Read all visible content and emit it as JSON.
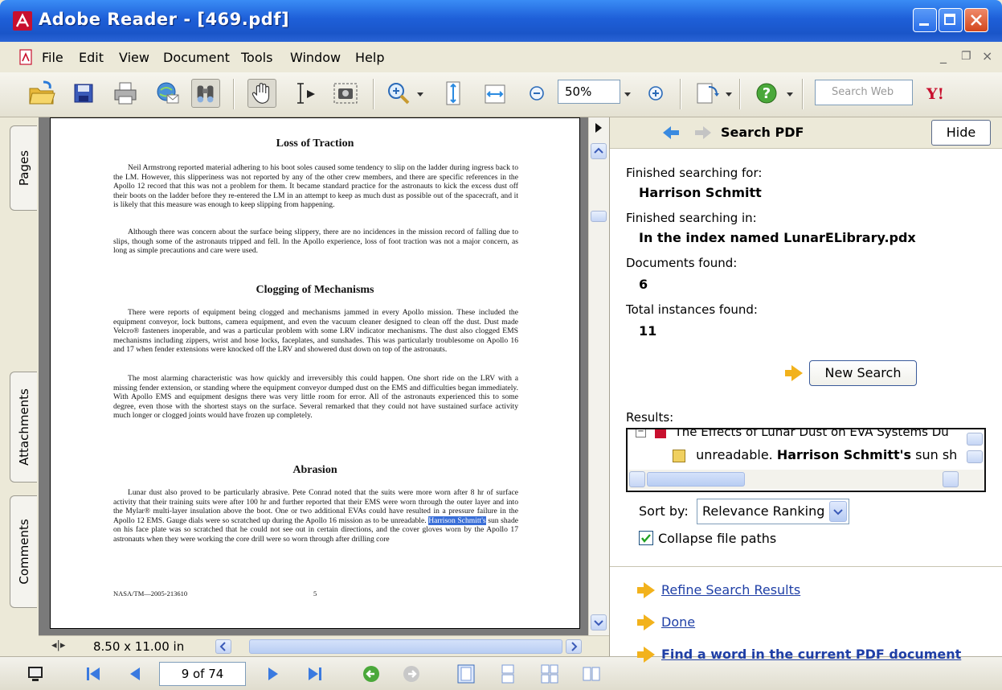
{
  "window": {
    "title": "Adobe Reader - [469.pdf]"
  },
  "menu": {
    "items": [
      "File",
      "Edit",
      "View",
      "Document",
      "Tools",
      "Window",
      "Help"
    ]
  },
  "toolbar": {
    "zoom": "50%",
    "search_placeholder": "Search Web"
  },
  "left_tabs": [
    "Pages",
    "Attachments",
    "Comments"
  ],
  "document": {
    "sections": [
      {
        "heading": "Loss of Traction",
        "paragraphs": [
          "Neil Armstrong reported material adhering to his boot soles caused some tendency to slip on the ladder during ingress back to the LM. However, this slipperiness was not reported by any of the other crew members, and there are specific references in the Apollo 12 record that this was not a problem for them. It became standard practice for the astronauts to kick the excess dust off their boots on the ladder before they re-entered the LM in an attempt to keep as much dust as possible out of the spacecraft, and it is likely that this measure was enough to keep slipping from happening.",
          "Although there was concern about the surface being slippery, there are no incidences in the mission record of falling due to slips, though some of the astronauts tripped and fell. In the Apollo experience, loss of foot traction was not a major concern, as long as simple precautions and care were used."
        ]
      },
      {
        "heading": "Clogging of Mechanisms",
        "paragraphs": [
          "There were reports of equipment being clogged and mechanisms jammed in every Apollo mission. These included the equipment conveyor, lock buttons, camera equipment, and even the vacuum cleaner designed to clean off the dust. Dust made Velcro® fasteners inoperable, and was a particular problem with some LRV indicator mechanisms. The dust also clogged EMS mechanisms including zippers, wrist and hose locks, faceplates, and sunshades. This was particularly troublesome on Apollo 16 and 17 when fender extensions were knocked off the LRV and showered dust down on top of the astronauts.",
          "The most alarming characteristic was how quickly and irreversibly this could happen. One short ride on the LRV with a missing fender extension, or standing where the equipment conveyor dumped dust on the EMS and difficulties began immediately. With Apollo EMS and equipment designs there was very little room for error. All of the astronauts experienced this to some degree, even those with the shortest stays on the surface. Several remarked that they could not have sustained surface activity much longer or clogged joints would have frozen up completely."
        ]
      },
      {
        "heading": "Abrasion",
        "before": "Lunar dust also proved to be particularly abrasive. Pete Conrad noted that the suits were more worn after 8 hr of surface activity that their training suits were after 100 hr and further reported that their EMS were worn through the outer layer and into the Mylar® multi-layer insulation above the boot. One or two additional EVAs could have resulted in a pressure failure in the Apollo 12 EMS. Gauge dials were so scratched up during the Apollo 16 mission as to be unreadable.",
        "highlight": "Harrison Schmitt's",
        "after": "sun shade on his face plate was so scratched that he could not see out in certain directions, and the cover gloves worn by the Apollo 17 astronauts when they were working the core drill were so worn through after drilling core"
      }
    ],
    "footer_left": "NASA/TM—2005-213610",
    "footer_page": "5"
  },
  "status": {
    "page_size": "8.50 x 11.00 in",
    "page_indicator": "9 of 74"
  },
  "search_pane": {
    "title": "Search PDF",
    "hide_label": "Hide",
    "searching_for_label": "Finished searching for:",
    "searching_for_value": "Harrison Schmitt",
    "searching_in_label": "Finished searching in:",
    "searching_in_value": "In the index named LunarELibrary.pdx",
    "documents_label": "Documents found:",
    "documents_value": "6",
    "instances_label": "Total instances found:",
    "instances_value": "11",
    "new_search_label": "New Search",
    "results_label": "Results:",
    "result_doc": "The Effects of Lunar Dust on EVA Systems Du",
    "result_prefix": "unreadable.",
    "result_bold": "Harrison Schmitt's",
    "result_suffix": "sun sh",
    "sort_label": "Sort by:",
    "sort_value": "Relevance Ranking",
    "collapse_label": "Collapse file paths",
    "links": [
      "Refine Search Results",
      "Done",
      "Find a word in the current PDF document"
    ]
  },
  "colors": {
    "title_bar": "#1e5fd8",
    "link": "#1f3fa6",
    "arrow": "#f2b21c",
    "highlight": "#3a6fd8"
  }
}
